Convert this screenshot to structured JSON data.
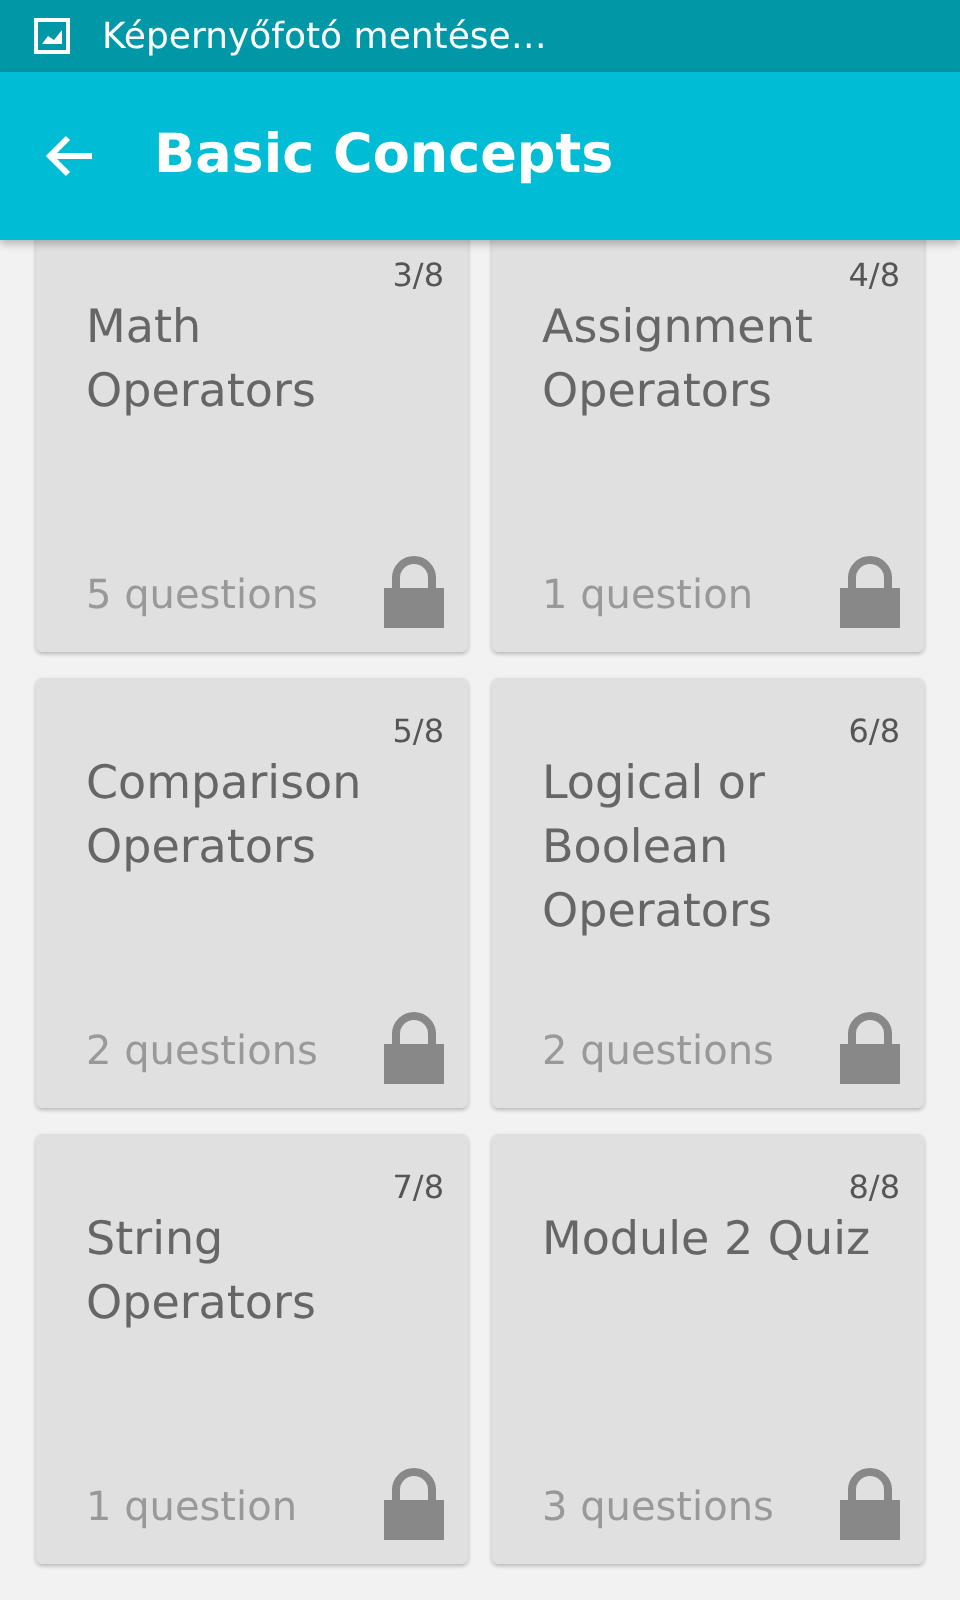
{
  "status_bar": {
    "notification": "Képernyőfotó mentése…"
  },
  "app_bar": {
    "title": "Basic Concepts"
  },
  "lessons": [
    {
      "number": "3/8",
      "title": "Math Operators",
      "questions": "5 questions",
      "locked": true
    },
    {
      "number": "4/8",
      "title": "Assignment Operators",
      "questions": "1 question",
      "locked": true
    },
    {
      "number": "5/8",
      "title": "Comparison Operators",
      "questions": "2 questions",
      "locked": true
    },
    {
      "number": "6/8",
      "title": "Logical or Boolean Operators",
      "questions": "2 questions",
      "locked": true
    },
    {
      "number": "7/8",
      "title": "String Operators",
      "questions": "1 question",
      "locked": true
    },
    {
      "number": "8/8",
      "title": "Module 2 Quiz",
      "questions": "3 questions",
      "locked": true
    }
  ]
}
